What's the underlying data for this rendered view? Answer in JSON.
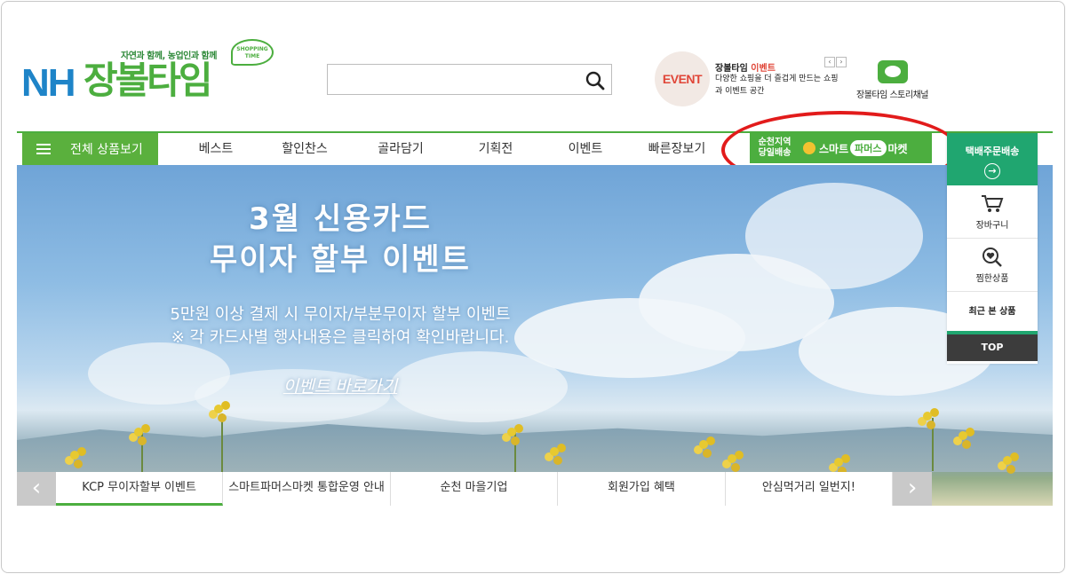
{
  "header": {
    "logo_slogan": "자연과 함께, 농업인과 함께",
    "logo_nh": "NH",
    "logo_name": "장볼타임",
    "logo_bubble": "SHOPPING TIME",
    "search_placeholder": "",
    "event": {
      "badge": "EVENT",
      "title_prefix": "장볼타임",
      "title_highlight": "이벤트",
      "desc": "다양한 쇼핑을 더 즐겁게 만드는 쇼핑과 이벤트 공간",
      "prev": "‹",
      "next": "›"
    },
    "story_label": "장볼타임 스토리채널"
  },
  "nav": {
    "all_label": "전체 상품보기",
    "items": [
      "베스트",
      "할인찬스",
      "골라담기",
      "기획전",
      "이벤트",
      "빠른장보기"
    ],
    "smart": {
      "local_line1": "순천지역",
      "local_line2": "당일배송",
      "brand_left": "스마트",
      "brand_pill": "파머스",
      "brand_right": "마켓"
    }
  },
  "hero": {
    "title_line1": "3월 신용카드",
    "title_line2": "무이자 할부 이벤트",
    "sub_line1": "5만원 이상 결제 시 무이자/부분무이자 할부 이벤트",
    "sub_line2": "※ 각 카드사별 행사내용은 클릭하여 확인바랍니다.",
    "link": "이벤트 바로가기"
  },
  "slide_tabs": {
    "prev": "‹",
    "next": "›",
    "items": [
      "KCP 무이자할부 이벤트",
      "스마트파머스마켓 통합운영 안내",
      "순천 마을기업",
      "회원가입 혜택",
      "안심먹거리 일번지!"
    ],
    "active_index": 0
  },
  "quick_menu": {
    "delivery": "택배주문배송",
    "delivery_arrow": "→",
    "cart": "장바구니",
    "wish": "찜한상품",
    "recent": "최근 본 상품",
    "top": "TOP"
  },
  "colors": {
    "brand_green": "#4cae3f",
    "nav_green": "#5ab03d",
    "teal": "#20a670",
    "annotation_red": "#e21b1b",
    "nh_blue": "#1e84c8"
  }
}
